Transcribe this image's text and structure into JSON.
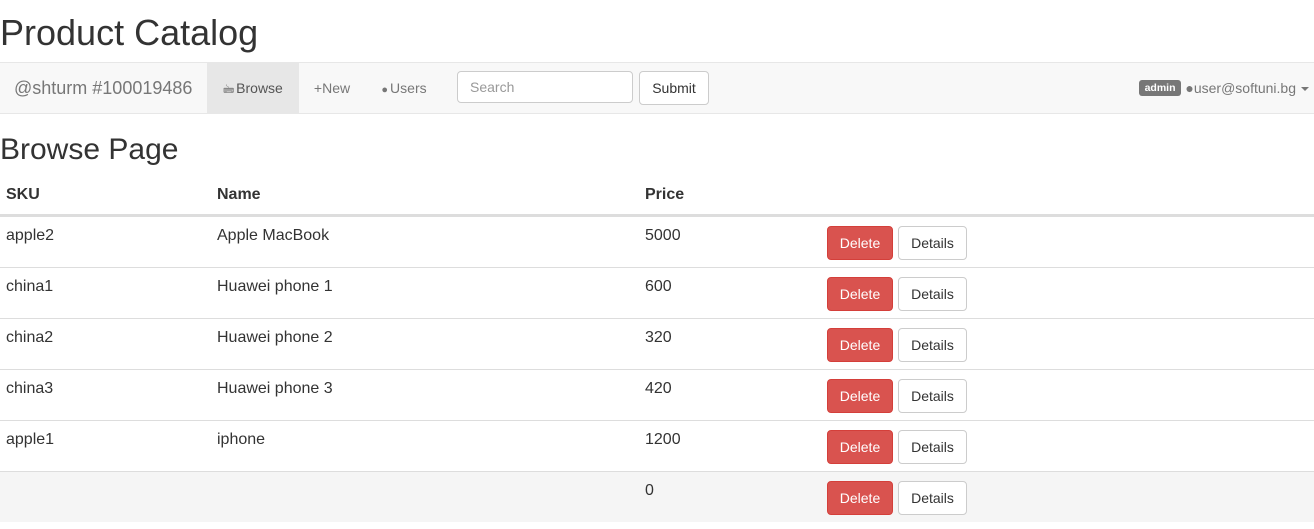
{
  "page_title": "Product Catalog",
  "navbar": {
    "brand": "@shturm #100019486",
    "items": [
      {
        "icon": "browse-icon",
        "glyph": "🖮",
        "label": "Browse",
        "active": true
      },
      {
        "icon": "plus-icon",
        "glyph": "+",
        "label": "New",
        "active": false
      },
      {
        "icon": "user-icon",
        "glyph": "●",
        "label": "Users",
        "active": false
      }
    ],
    "search": {
      "placeholder": "Search",
      "value": ""
    },
    "submit_label": "Submit",
    "user": {
      "role_badge": "admin",
      "icon_glyph": "●",
      "email": "user@softuni.bg"
    }
  },
  "section_title": "Browse Page",
  "table": {
    "columns": [
      "SKU",
      "Name",
      "Price",
      ""
    ],
    "rows": [
      {
        "sku": "apple2",
        "name": "Apple MacBook",
        "price": "5000"
      },
      {
        "sku": "china1",
        "name": "Huawei phone 1",
        "price": "600"
      },
      {
        "sku": "china2",
        "name": "Huawei phone 2",
        "price": "320"
      },
      {
        "sku": "china3",
        "name": "Huawei phone 3",
        "price": "420"
      },
      {
        "sku": "apple1",
        "name": "iphone",
        "price": "1200"
      },
      {
        "sku": "",
        "name": "",
        "price": "0"
      }
    ],
    "delete_label": "Delete",
    "details_label": "Details"
  },
  "colors": {
    "danger": "#d9534f",
    "navbar_bg": "#f8f8f8",
    "active_nav": "#e7e7e7",
    "badge": "#777777"
  }
}
